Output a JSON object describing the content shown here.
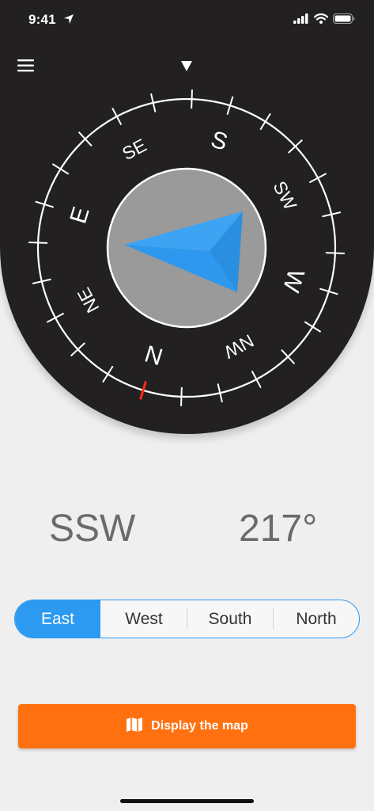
{
  "status_bar": {
    "time": "9:41"
  },
  "compass": {
    "direction": "SSW",
    "heading": "217°",
    "cardinals": [
      "N",
      "E",
      "S",
      "W"
    ],
    "intercardinals": [
      "NE",
      "SE",
      "SW",
      "NW"
    ],
    "colors": {
      "background": "#222020",
      "dial": "#ffffff",
      "center": "#9a9a9a",
      "needle": "#2e98ef",
      "north_mark": "#ff2a1a"
    }
  },
  "segments": {
    "items": [
      {
        "label": "East",
        "active": true
      },
      {
        "label": "West",
        "active": false
      },
      {
        "label": "South",
        "active": false
      },
      {
        "label": "North",
        "active": false
      }
    ]
  },
  "map_button": {
    "label": "Display the map",
    "icon": "map-icon"
  },
  "icons": [
    "location-arrow-icon",
    "signal-icon",
    "wifi-icon",
    "battery-icon",
    "hamburger-menu-icon",
    "heading-marker-icon"
  ]
}
